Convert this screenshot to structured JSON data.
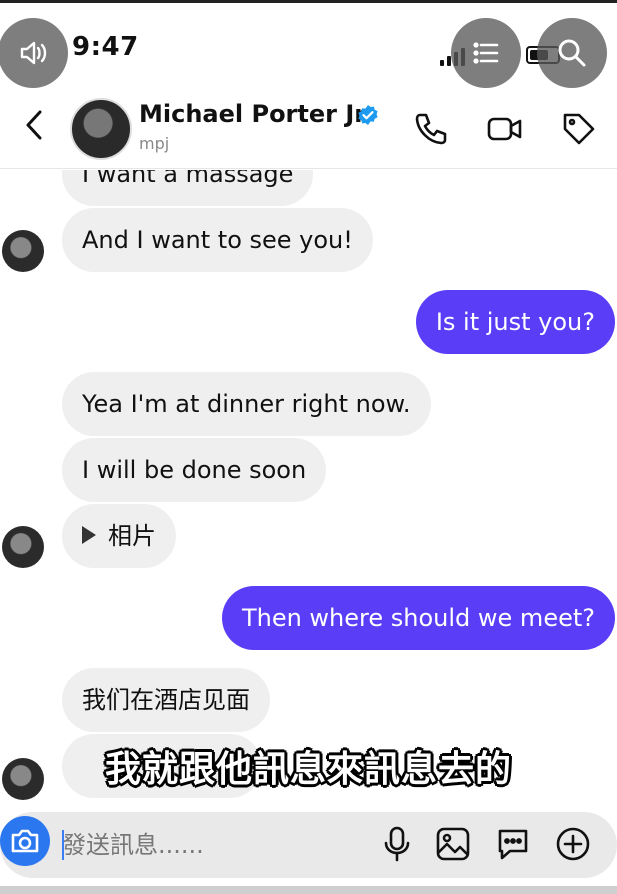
{
  "status_bar": {
    "time": "9:47"
  },
  "header": {
    "contact_name": "Michael Porter Jr.",
    "contact_username": "mpj",
    "verified": true
  },
  "messages": [
    {
      "id": "m1",
      "direction": "incoming",
      "text": "I want a massage"
    },
    {
      "id": "m2",
      "direction": "incoming",
      "text": "And I want to see you!"
    },
    {
      "id": "m3",
      "direction": "outgoing",
      "text": "Is it just you?"
    },
    {
      "id": "m4",
      "direction": "incoming",
      "text": "Yea I'm at dinner right now."
    },
    {
      "id": "m5",
      "direction": "incoming",
      "text": "I will be done soon"
    },
    {
      "id": "m6",
      "direction": "incoming",
      "text": "相片",
      "type": "photo"
    },
    {
      "id": "m7",
      "direction": "outgoing",
      "text": "Then where should we meet?"
    },
    {
      "id": "m8",
      "direction": "incoming",
      "text": "我们在酒店见面"
    }
  ],
  "subtitle": "我就跟他訊息來訊息去的",
  "composer": {
    "placeholder": "發送訊息......"
  },
  "colors": {
    "outgoing_bubble": "#5a3ef7",
    "incoming_bubble": "#efefef",
    "verified_badge": "#1d9bf0",
    "camera_button": "#2b77f0"
  },
  "icons": {
    "overlay": [
      "volume-icon",
      "list-icon",
      "search-icon"
    ],
    "header": [
      "back-icon",
      "phone-icon",
      "video-icon",
      "tag-icon"
    ],
    "composer": [
      "camera-icon",
      "microphone-icon",
      "image-icon",
      "sticker-icon",
      "plus-icon"
    ]
  }
}
